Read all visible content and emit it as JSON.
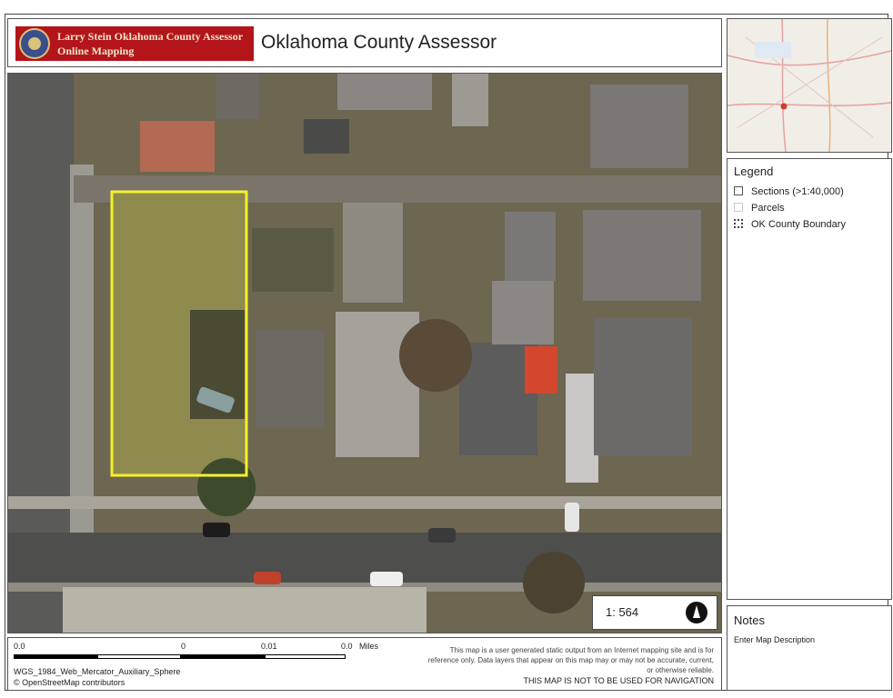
{
  "header": {
    "logo_line1": "Larry Stein Oklahoma County Assessor",
    "logo_line2": "Online Mapping",
    "title": "Oklahoma County Assessor"
  },
  "map": {
    "scale_text": "1: 564",
    "north_arrow_icon": "north-arrow-icon",
    "highlight_color": "#f5f12a"
  },
  "legend": {
    "title": "Legend",
    "items": [
      {
        "label": "Sections (>1:40,000)",
        "icon": "square-outline-icon"
      },
      {
        "label": "Parcels",
        "icon": "square-faint-icon"
      },
      {
        "label": "OK County Boundary",
        "icon": "square-dotted-icon"
      }
    ]
  },
  "notes": {
    "title": "Notes",
    "text": "Enter Map Description"
  },
  "footer": {
    "ticks": [
      "0.0",
      "0",
      "0.01",
      "0.0"
    ],
    "units": "Miles",
    "projection": "WGS_1984_Web_Mercator_Auxiliary_Sphere",
    "attribution": "© OpenStreetMap contributors",
    "disclaimer": "This map is a user generated static output from an Internet mapping site and is for reference only. Data layers that appear on this map may or may not be accurate, current, or otherwise reliable.",
    "nav_warning": "THIS MAP IS NOT TO BE USED FOR NAVIGATION"
  }
}
